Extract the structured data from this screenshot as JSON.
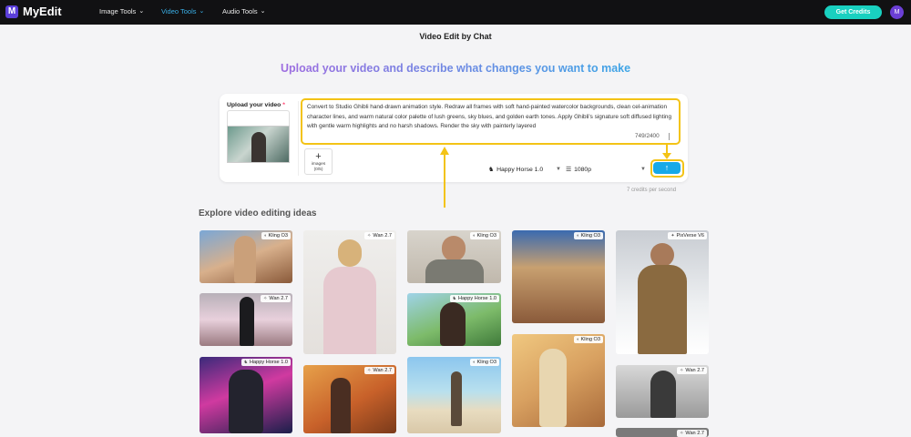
{
  "app": {
    "name": "MyEdit",
    "logo_letter": "M"
  },
  "nav": {
    "items": [
      {
        "label": "Image Tools"
      },
      {
        "label": "Video Tools"
      },
      {
        "label": "Audio Tools"
      }
    ],
    "active_index": 1,
    "get_credits": "Get Credits",
    "avatar_letter": "M"
  },
  "page": {
    "title": "Video Edit by Chat",
    "headline": "Upload your video and describe what changes you want to make"
  },
  "editor": {
    "upload_label": "Upload your video",
    "required_mark": "*",
    "prompt": "Convert to Studio Ghibli hand-drawn animation style. Redraw all frames with soft hand-painted watercolor backgrounds, clean cel-animation character lines, and warm natural color palette of lush greens, sky blues, and golden earth tones. Apply Ghibli's signature soft diffused lighting with gentle warm highlights and no harsh shadows. Render the sky with painterly layered",
    "char_count": "749/2400",
    "add_images_line1": "images",
    "add_images_line2": "(0/5)",
    "model": "Happy Horse 1.0",
    "resolution": "1080p",
    "submit_glyph": "↑",
    "credits_note": "7 credits per second"
  },
  "explore": {
    "title": "Explore video editing ideas",
    "tiles": [
      {
        "tag": "Kling O3"
      },
      {
        "tag": "Wan 2.7"
      },
      {
        "tag": "Happy Horse 1.0"
      },
      {
        "tag": "Wan 2.7"
      },
      {
        "tag": "Wan 2.7"
      },
      {
        "tag": "Kling O3"
      },
      {
        "tag": "Happy Horse 1.0"
      },
      {
        "tag": "Kling O3"
      },
      {
        "tag": "Kling O3"
      },
      {
        "tag": "Kling O3"
      },
      {
        "tag": "PixVerse V6"
      },
      {
        "tag": "Wan 2.7"
      },
      {
        "tag": "Wan 2.7"
      }
    ]
  },
  "colors": {
    "accent": "#17a9e8",
    "brand": "#5b3fd9",
    "highlight": "#f3c316",
    "credits_button": "#19d0c0"
  },
  "icons": [
    "logo-icon",
    "chevron-down-icon",
    "plus-icon",
    "horse-icon",
    "sliders-icon",
    "arrow-up-icon",
    "kling-icon",
    "wan-icon",
    "pixverse-icon"
  ]
}
